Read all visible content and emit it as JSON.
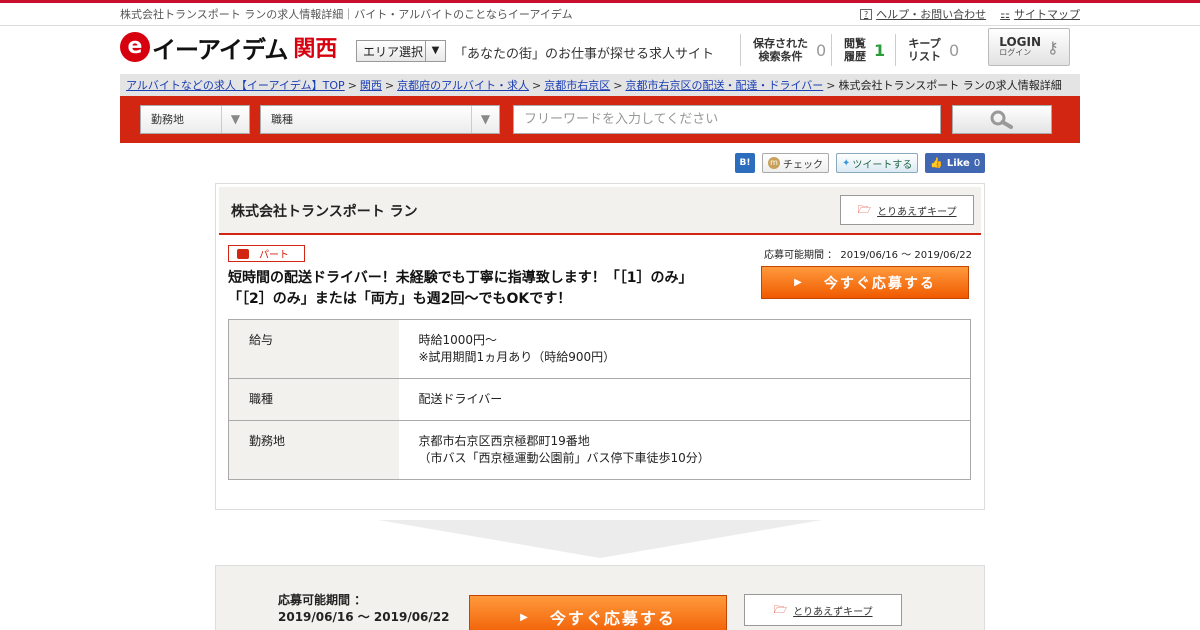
{
  "topbar": {
    "text": "株式会社トランスポート ランの求人情報詳細｜バイト・アルバイトのことならイーアイデム",
    "help": "ヘルプ・お問い合わせ",
    "sitemap": "サイトマップ"
  },
  "header": {
    "logo_brand": "イーアイデム",
    "logo_region": "関西",
    "area_select": "エリア選択",
    "catchphrase": "「あなたの街」のお仕事が探せる求人サイト",
    "saved_label_1": "保存された",
    "saved_label_2": "検索条件",
    "saved_count": "0",
    "history_label_1": "閲覧",
    "history_label_2": "履歴",
    "history_count": "1",
    "keep_label_1": "キープ",
    "keep_label_2": "リスト",
    "keep_count": "0",
    "login_label": "LOGIN",
    "login_sub": "ログイン"
  },
  "breadcrumb": {
    "items": [
      "アルバイトなどの求人【イーアイデム】TOP",
      "関西",
      "京都府のアルバイト・求人",
      "京都市右京区",
      "京都市右京区の配送・配達・ドライバー"
    ],
    "current": "株式会社トランスポート ランの求人情報詳細",
    "separator": ">"
  },
  "search": {
    "location": "勤務地",
    "job_type": "職種",
    "placeholder": "フリーワードを入力してください"
  },
  "social": {
    "hatena": "B!",
    "mixi": "チェック",
    "tweet": "ツイートする",
    "like": "Like",
    "like_count": "0"
  },
  "job": {
    "company": "株式会社トランスポート ラン",
    "keep_label": "とりあえずキープ",
    "badge": "パート",
    "period": "応募可能期間 ： 2019/06/16 ～ 2019/06/22",
    "title_line1": "短時間の配送ドライバー！未経験でも丁寧に指導致します！「［1］のみ」",
    "title_line2": "「［2］のみ」または「両方」も週2回〜でもOKです！",
    "apply_label": "今すぐ応募する",
    "details": [
      {
        "key": "給与",
        "v1": "時給1000円〜",
        "v2": "※試用期間1ヵ月あり（時給900円）"
      },
      {
        "key": "職種",
        "v1": "配送ドライバー",
        "v2": ""
      },
      {
        "key": "勤務地",
        "v1": "京都市右京区西京極郡町19番地",
        "v2": "（市バス「西京極運動公園前」バス停下車徒歩10分）"
      }
    ]
  },
  "bottom": {
    "period_label": "応募可能期間 ：",
    "period_value": "2019/06/16 ～ 2019/06/22",
    "apply_label": "今すぐ応募する",
    "keep_label": "とりあえずキープ"
  },
  "colors": {
    "brand_red": "#d22512",
    "apply_orange": "#f05a00",
    "panel_beige": "#f3f1ed"
  }
}
